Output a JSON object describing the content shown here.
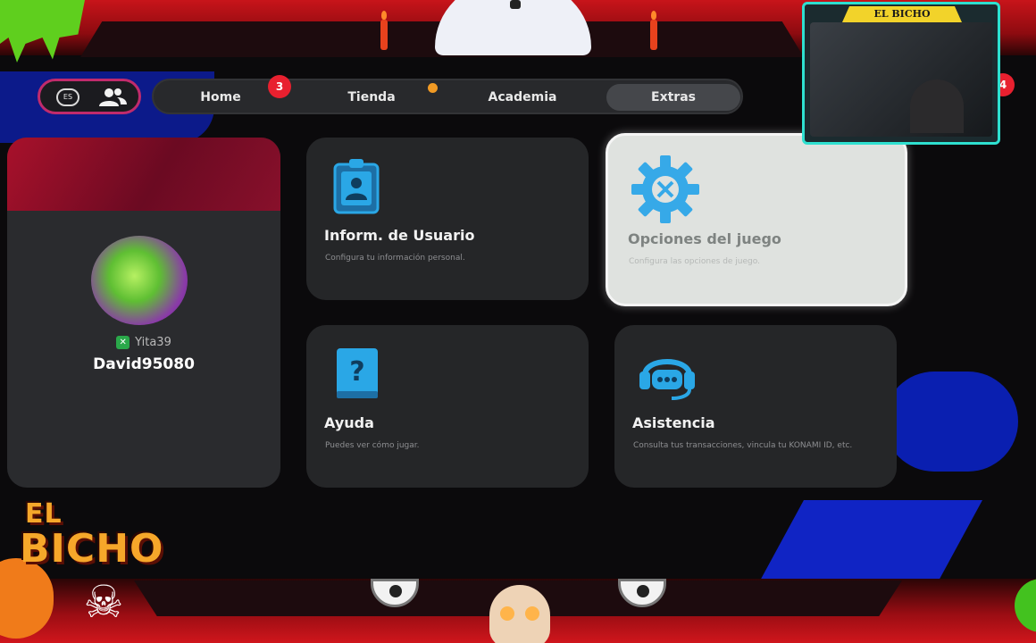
{
  "overlay": {
    "webcam_title": "EL BICHO",
    "logo_line1": "EL",
    "logo_line2": "BICHO",
    "logo_jolly": "☠",
    "edge_badge": "4"
  },
  "top_icons": {
    "language_label": "ES"
  },
  "nav": {
    "tabs": [
      {
        "label": "Home",
        "badge": "3"
      },
      {
        "label": "Tienda",
        "dot": true
      },
      {
        "label": "Academia"
      },
      {
        "label": "Extras",
        "active": true
      }
    ]
  },
  "profile": {
    "gamertag": "Yita39",
    "username": "David95080"
  },
  "cards": [
    {
      "icon": "user-badge-icon",
      "title": "Inform. de Usuario",
      "description": "Configura tu información personal."
    },
    {
      "icon": "gear-icon",
      "title": "Opciones del juego",
      "description": "Configura las opciones de juego.",
      "selected": true
    },
    {
      "icon": "help-book-icon",
      "title": "Ayuda",
      "description": "Puedes ver cómo jugar."
    },
    {
      "icon": "headset-support-icon",
      "title": "Asistencia",
      "description": "Consulta tus transacciones, vincula tu KONAMI ID, etc."
    }
  ],
  "colors": {
    "accent_blue": "#2aa7e6",
    "badge_red": "#e8202f",
    "notify_orange": "#f19a24",
    "profile_banner": "#a8112b"
  }
}
